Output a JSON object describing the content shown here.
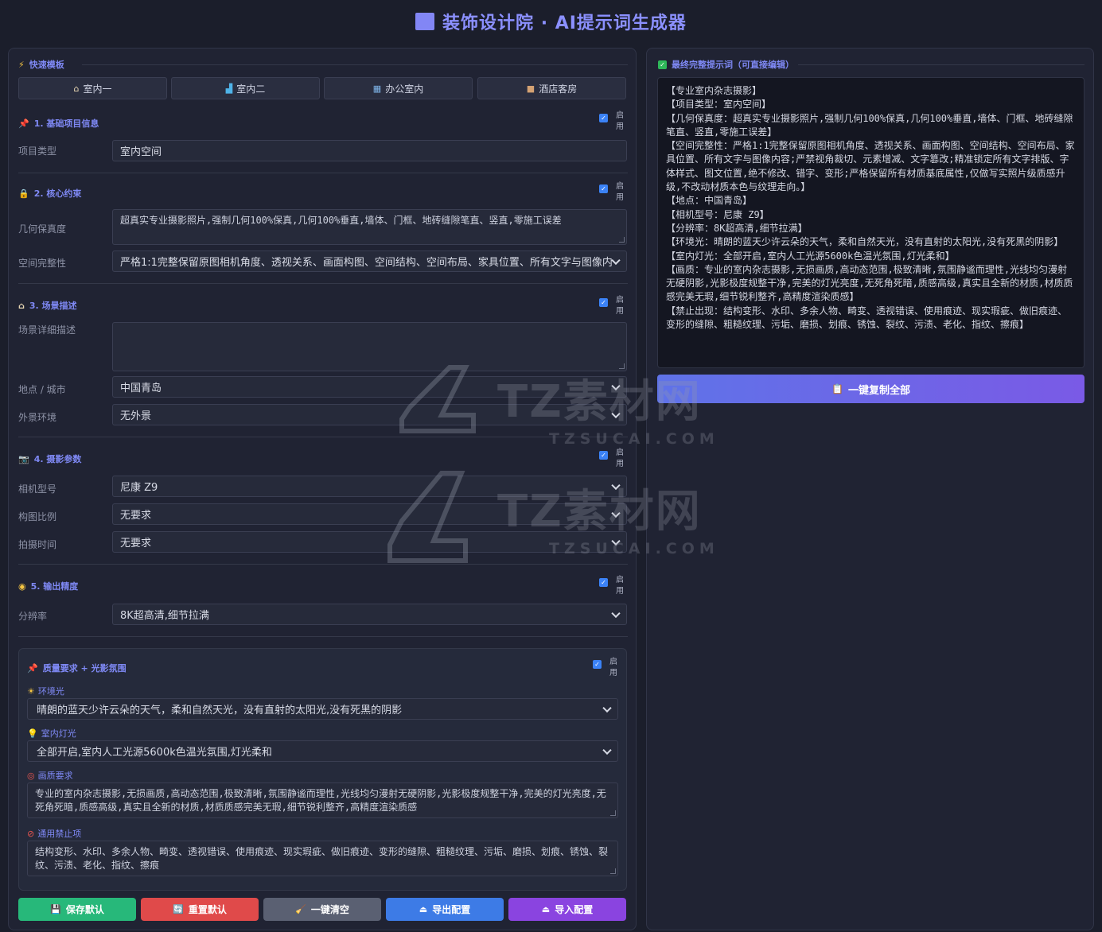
{
  "app": {
    "title": "装饰设计院 · AI提示词生成器"
  },
  "templates": {
    "header": "快速模板",
    "buttons": [
      {
        "icon": "house-icon",
        "label": "室内一"
      },
      {
        "icon": "bucket-icon",
        "label": "室内二"
      },
      {
        "icon": "office-icon",
        "label": "办公室内"
      },
      {
        "icon": "box-icon",
        "label": "酒店客房"
      }
    ]
  },
  "enable_label": "启用",
  "sections": {
    "basic": {
      "title": "1. 基础项目信息",
      "project_type_label": "项目类型",
      "project_type_value": "室内空间"
    },
    "core": {
      "title": "2. 核心约束",
      "geometry_label": "几何保真度",
      "geometry_value": "超真实专业摄影照片,强制几何100%保真,几何100%垂直,墙体、门框、地砖缝隙笔直、竖直,零施工误差",
      "integrity_label": "空间完整性",
      "integrity_value": "严格1:1完整保留原图相机角度、透视关系、画面构图、空间结构、空间布局、家具位置、所有文字与图像内"
    },
    "scene": {
      "title": "3. 场景描述",
      "detail_label": "场景详细描述",
      "detail_value": "",
      "location_label": "地点 / 城市",
      "location_value": "中国青岛",
      "exterior_label": "外景环境",
      "exterior_value": "无外景"
    },
    "camera": {
      "title": "4. 摄影参数",
      "model_label": "相机型号",
      "model_value": "尼康 Z9",
      "ratio_label": "构图比例",
      "ratio_value": "无要求",
      "time_label": "拍摄时间",
      "time_value": "无要求"
    },
    "output": {
      "title": "5. 输出精度",
      "resolution_label": "分辨率",
      "resolution_value": "8K超高清,细节拉满"
    },
    "quality": {
      "title": "质量要求 + 光影氛围",
      "ambient_label": "环境光",
      "ambient_value": "晴朗的蓝天少许云朵的天气，柔和自然天光，没有直射的太阳光,没有死黑的阴影",
      "indoor_label": "室内灯光",
      "indoor_value": "全部开启,室内人工光源5600k色温光氛围,灯光柔和",
      "image_label": "画质要求",
      "image_value": "专业的室内杂志摄影,无损画质,高动态范围,极致清晰,氛围静谧而理性,光线均匀漫射无硬阴影,光影极度规整干净,完美的灯光亮度,无死角死暗,质感高级,真实且全新的材质,材质质感完美无瑕,细节锐利整齐,高精度渲染质感",
      "forbid_label": "通用禁止项",
      "forbid_value": "结构变形、水印、多余人物、畸变、透视错误、使用痕迹、现实瑕疵、做旧痕迹、变形的缝隙、粗糙纹理、污垢、磨损、划痕、锈蚀、裂纹、污渍、老化、指纹、擦痕"
    }
  },
  "actions": [
    {
      "icon": "floppy-icon",
      "label": "保存默认",
      "color": "#27b87a"
    },
    {
      "icon": "reset-icon",
      "label": "重置默认",
      "color": "#e04a4a"
    },
    {
      "icon": "broom-icon",
      "label": "一键清空",
      "color": "#5a6072"
    },
    {
      "icon": "export-icon",
      "label": "导出配置",
      "color": "#3d7be6"
    },
    {
      "icon": "import-icon",
      "label": "导入配置",
      "color": "#8a44e0"
    }
  ],
  "final": {
    "header": "最终完整提示词（可直接编辑）",
    "lines": [
      "【专业室内杂志摄影】",
      "【项目类型：室内空间】",
      "【几何保真度：超真实专业摄影照片,强制几何100%保真,几何100%垂直,墙体、门框、地砖缝隙笔直、竖直,零施工误差】",
      "【空间完整性：严格1:1完整保留原图相机角度、透视关系、画面构图、空间结构、空间布局、家具位置、所有文字与图像内容;严禁视角裁切、元素增减、文字篡改;精准锁定所有文字排版、字体样式、图文位置,绝不修改、错字、变形;严格保留所有材质基底属性,仅做写实照片级质感升级,不改动材质本色与纹理走向。】",
      "【地点：中国青岛】",
      "【相机型号：尼康 Z9】",
      "【分辨率：8K超高清,细节拉满】",
      "【环境光：晴朗的蓝天少许云朵的天气，柔和自然天光，没有直射的太阳光,没有死黑的阴影】",
      "【室内灯光：全部开启,室内人工光源5600k色温光氛围,灯光柔和】",
      "【画质：专业的室内杂志摄影,无损画质,高动态范围,极致清晰,氛围静谧而理性,光线均匀漫射无硬阴影,光影极度规整干净,完美的灯光亮度,无死角死暗,质感高级,真实且全新的材质,材质质感完美无瑕,细节锐利整齐,高精度渲染质感】",
      "【禁止出现：结构变形、水印、多余人物、畸变、透视错误、使用痕迹、现实瑕疵、做旧痕迹、变形的缝隙、粗糙纹理、污垢、磨损、划痕、锈蚀、裂纹、污渍、老化、指纹、擦痕】"
    ],
    "copy_label": "一键复制全部"
  },
  "watermark": {
    "text": "TZ素材网",
    "url": "TZSUCAI.COM"
  }
}
